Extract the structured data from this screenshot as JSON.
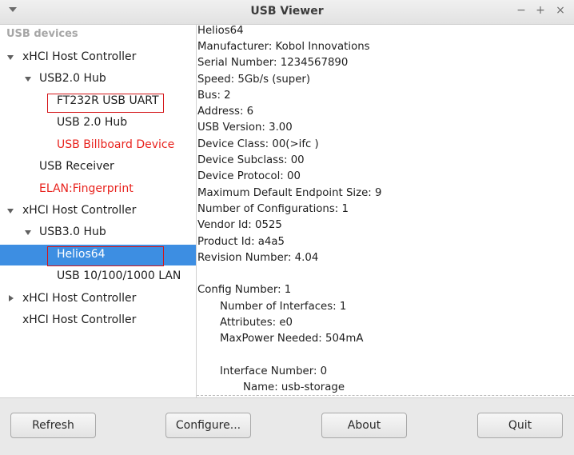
{
  "window": {
    "title": "USB Viewer",
    "min": "−",
    "max": "+",
    "close": "×"
  },
  "tree": {
    "header": "USB devices",
    "rows": [
      {
        "label": "xHCI Host Controller",
        "color": "normal"
      },
      {
        "label": "USB2.0 Hub",
        "color": "normal"
      },
      {
        "label": "FT232R USB UART",
        "color": "normal"
      },
      {
        "label": "USB 2.0 Hub",
        "color": "normal"
      },
      {
        "label": "USB Billboard Device",
        "color": "red"
      },
      {
        "label": "USB Receiver",
        "color": "normal"
      },
      {
        "label": "ELAN:Fingerprint",
        "color": "red"
      },
      {
        "label": "xHCI Host Controller",
        "color": "normal"
      },
      {
        "label": "USB3.0 Hub",
        "color": "normal"
      },
      {
        "label": "Helios64",
        "color": "normal",
        "selected": true
      },
      {
        "label": "USB 10/100/1000 LAN",
        "color": "normal"
      },
      {
        "label": "xHCI Host Controller",
        "color": "normal"
      },
      {
        "label": "xHCI Host Controller",
        "color": "normal"
      }
    ]
  },
  "details": {
    "lines": [
      "Helios64",
      "Manufacturer: Kobol Innovations",
      "Serial Number: 1234567890",
      "Speed: 5Gb/s (super)",
      "Bus:  2",
      "Address:  6",
      "USB Version:  3.00",
      "Device Class: 00(>ifc )",
      "Device Subclass: 00",
      "Device Protocol: 00",
      "Maximum Default Endpoint Size: 9",
      "Number of Configurations: 1",
      "Vendor Id: 0525",
      "Product Id: a4a5",
      "Revision Number:  4.04",
      "",
      "Config Number: 1",
      "Number of Interfaces: 1",
      "Attributes: e0",
      "MaxPower Needed: 504mA",
      "",
      "Interface Number: 0",
      "Name: usb-storage"
    ]
  },
  "buttons": {
    "refresh": "Refresh",
    "configure": "Configure...",
    "about": "About",
    "quit": "Quit"
  },
  "colors": {
    "selection": "#3d8ee2",
    "warning_text": "#e8231e",
    "highlight_box": "#d4161a"
  }
}
